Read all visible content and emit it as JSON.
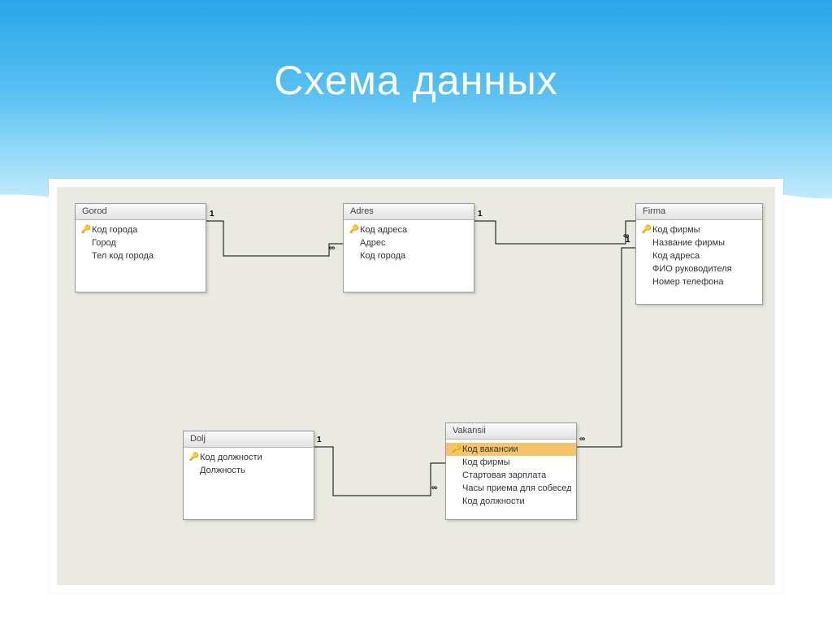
{
  "slide": {
    "title": "Схема данных"
  },
  "entities": {
    "gorod": {
      "title": "Gorod",
      "fields": [
        "Код города",
        "Город",
        "Тел код города"
      ],
      "pk_index": 0
    },
    "adres": {
      "title": "Adres",
      "fields": [
        "Код адреса",
        "Адрес",
        "Код города"
      ],
      "pk_index": 0
    },
    "firma": {
      "title": "Firma",
      "fields": [
        "Код фирмы",
        "Название фирмы",
        "Код адреса",
        "ФИО руководителя",
        "Номер телефона"
      ],
      "pk_index": 0
    },
    "dolj": {
      "title": "Dolj",
      "fields": [
        "Код должности",
        "Должность"
      ],
      "pk_index": 0
    },
    "vakansii": {
      "title": "Vakansii",
      "fields": [
        "Код вакансии",
        "Код фирмы",
        "Стартовая зарплата",
        "Часы приема для собеседований",
        "Код должности"
      ],
      "pk_index": 0,
      "selected_index": 0
    }
  },
  "relations": [
    {
      "from": "gorod",
      "to": "adres",
      "from_card": "1",
      "to_card": "∞"
    },
    {
      "from": "adres",
      "to": "firma",
      "from_card": "1",
      "to_card": "∞"
    },
    {
      "from": "dolj",
      "to": "vakansii",
      "from_card": "1",
      "to_card": "∞"
    },
    {
      "from": "firma",
      "to": "vakansii",
      "from_card": "1",
      "to_card": "∞"
    }
  ],
  "cardinality_symbols": {
    "one": "1",
    "many": "∞"
  }
}
